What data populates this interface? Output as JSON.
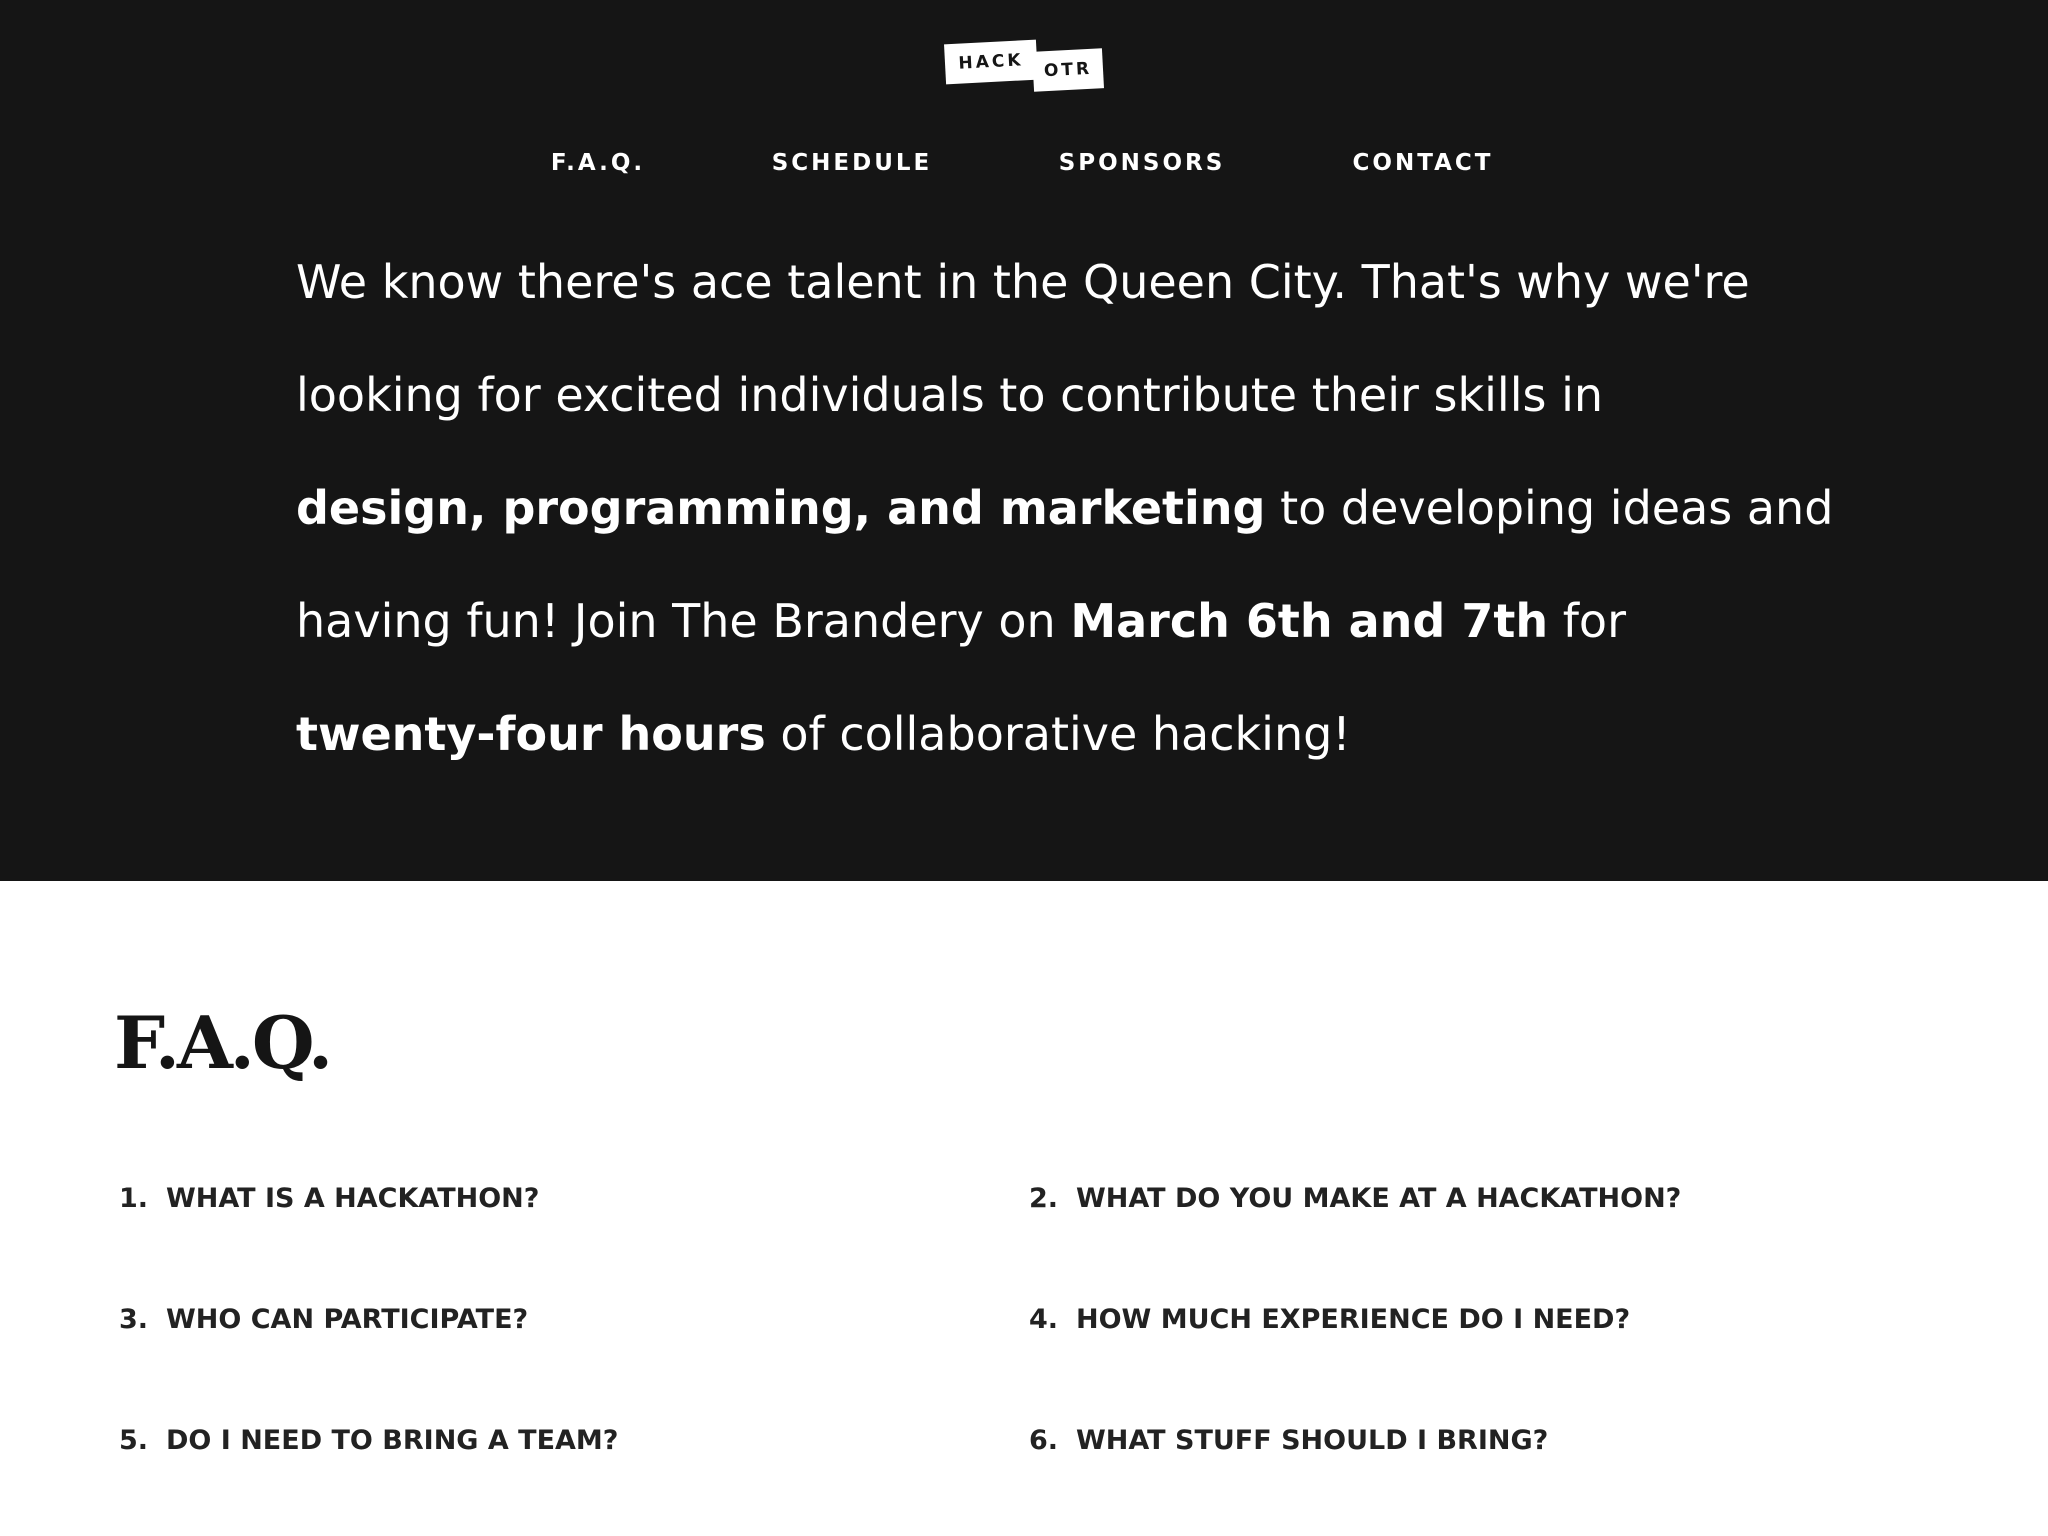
{
  "logo": {
    "part1": "HACK",
    "part2": "OTR"
  },
  "nav": [
    {
      "label": "F.A.Q."
    },
    {
      "label": "SCHEDULE"
    },
    {
      "label": "SPONSORS"
    },
    {
      "label": "CONTACT"
    }
  ],
  "intro": {
    "line1": "We know there's ace talent in the Queen City. That's why we're",
    "line2": "looking for excited individuals to contribute their skills in",
    "line3_bold": "design, programming, and marketing",
    "line3_rest": " to developing ideas and",
    "line4_start": "having fun! Join The Brandery on ",
    "line4_bold": "March 6th and 7th",
    "line4_end": " for",
    "line5_bold": "twenty-four hours",
    "line5_rest": " of collaborative hacking!"
  },
  "faq": {
    "title": "F.A.Q.",
    "items": [
      {
        "num": "1.",
        "question": "WHAT IS A HACKATHON?"
      },
      {
        "num": "2.",
        "question": "WHAT DO YOU MAKE AT A HACKATHON?"
      },
      {
        "num": "3.",
        "question": "WHO CAN PARTICIPATE?"
      },
      {
        "num": "4.",
        "question": "HOW MUCH EXPERIENCE DO I NEED?"
      },
      {
        "num": "5.",
        "question": "DO I NEED TO BRING A TEAM?"
      },
      {
        "num": "6.",
        "question": "WHAT STUFF SHOULD I BRING?"
      }
    ]
  },
  "colors": {
    "hero_background": "#151515",
    "hero_text": "#ffffff",
    "page_background": "#ffffff",
    "body_text": "#222222"
  }
}
